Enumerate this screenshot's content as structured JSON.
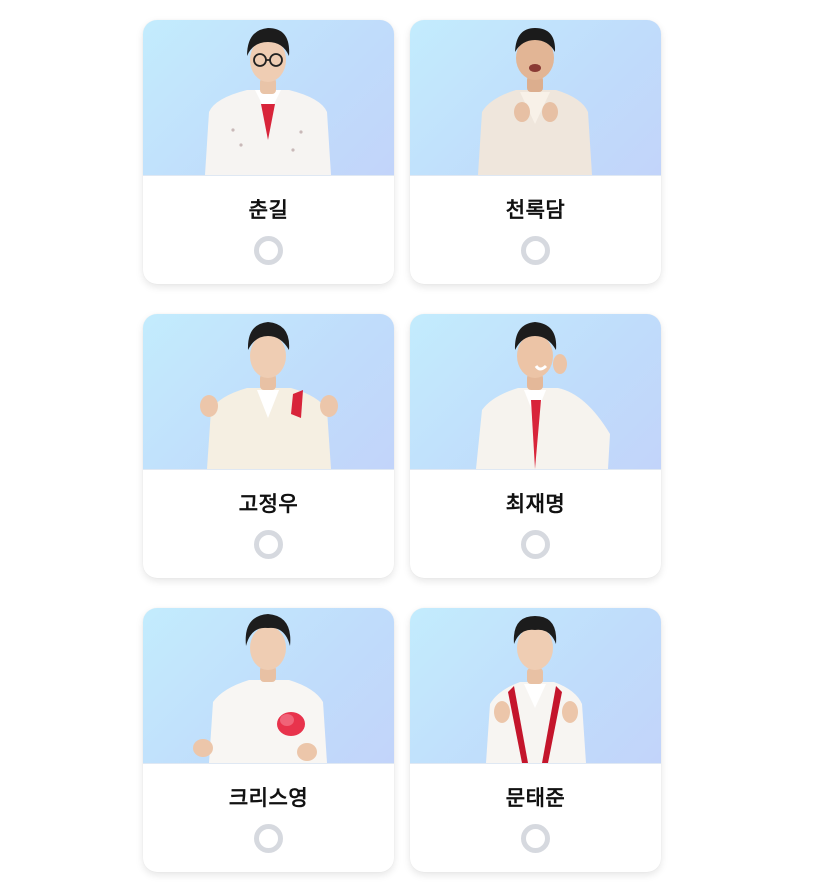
{
  "candidates": [
    {
      "name": "춘길",
      "selected": false
    },
    {
      "name": "천록담",
      "selected": false
    },
    {
      "name": "고정우",
      "selected": false
    },
    {
      "name": "최재명",
      "selected": false
    },
    {
      "name": "크리스영",
      "selected": false
    },
    {
      "name": "문태준",
      "selected": false
    }
  ],
  "colors": {
    "photo_gradient_start": "#c3ecfd",
    "photo_gradient_end": "#c2d4fa",
    "radio_ring": "#d6d9df",
    "name_text": "#111111",
    "suit_white": "#f4f1ec",
    "accent_red": "#d8243a"
  }
}
